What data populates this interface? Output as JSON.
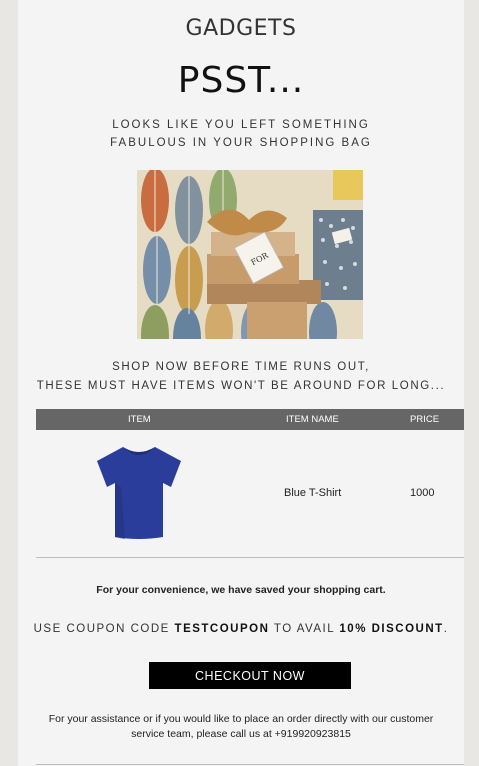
{
  "brand": "GADGETS",
  "headline": "PSST...",
  "subline": [
    "LOOKS LIKE YOU LEFT SOMETHING",
    "FABULOUS IN YOUR SHOPPING BAG"
  ],
  "cta_text": [
    "SHOP NOW BEFORE TIME RUNS OUT,",
    "THESE MUST HAVE ITEMS WON'T BE AROUND FOR LONG..."
  ],
  "table": {
    "headers": {
      "item": "ITEM",
      "item_name": "ITEM NAME",
      "price": "PRICE"
    },
    "rows": [
      {
        "image_icon": "blue-tshirt",
        "name": "Blue T-Shirt",
        "price": "1000"
      }
    ]
  },
  "saved_cart": "For your convenience, we have saved your shopping cart.",
  "coupon": {
    "prefix": "USE COUPON CODE ",
    "code": "TESTCOUPON",
    "middle": " TO AVAIL ",
    "discount": "10% DISCOUNT",
    "suffix": "."
  },
  "checkout_label": "CHECKOUT NOW",
  "assistance": "For your assistance or if you would like to place an order directly with our customer service team, please call us at +919920923815",
  "colors": {
    "page_bg": "#f4f4f4",
    "outer_bg": "#e8e7e4",
    "table_header": "#666666",
    "button": "#000000",
    "tshirt": "#2a3d9a"
  }
}
